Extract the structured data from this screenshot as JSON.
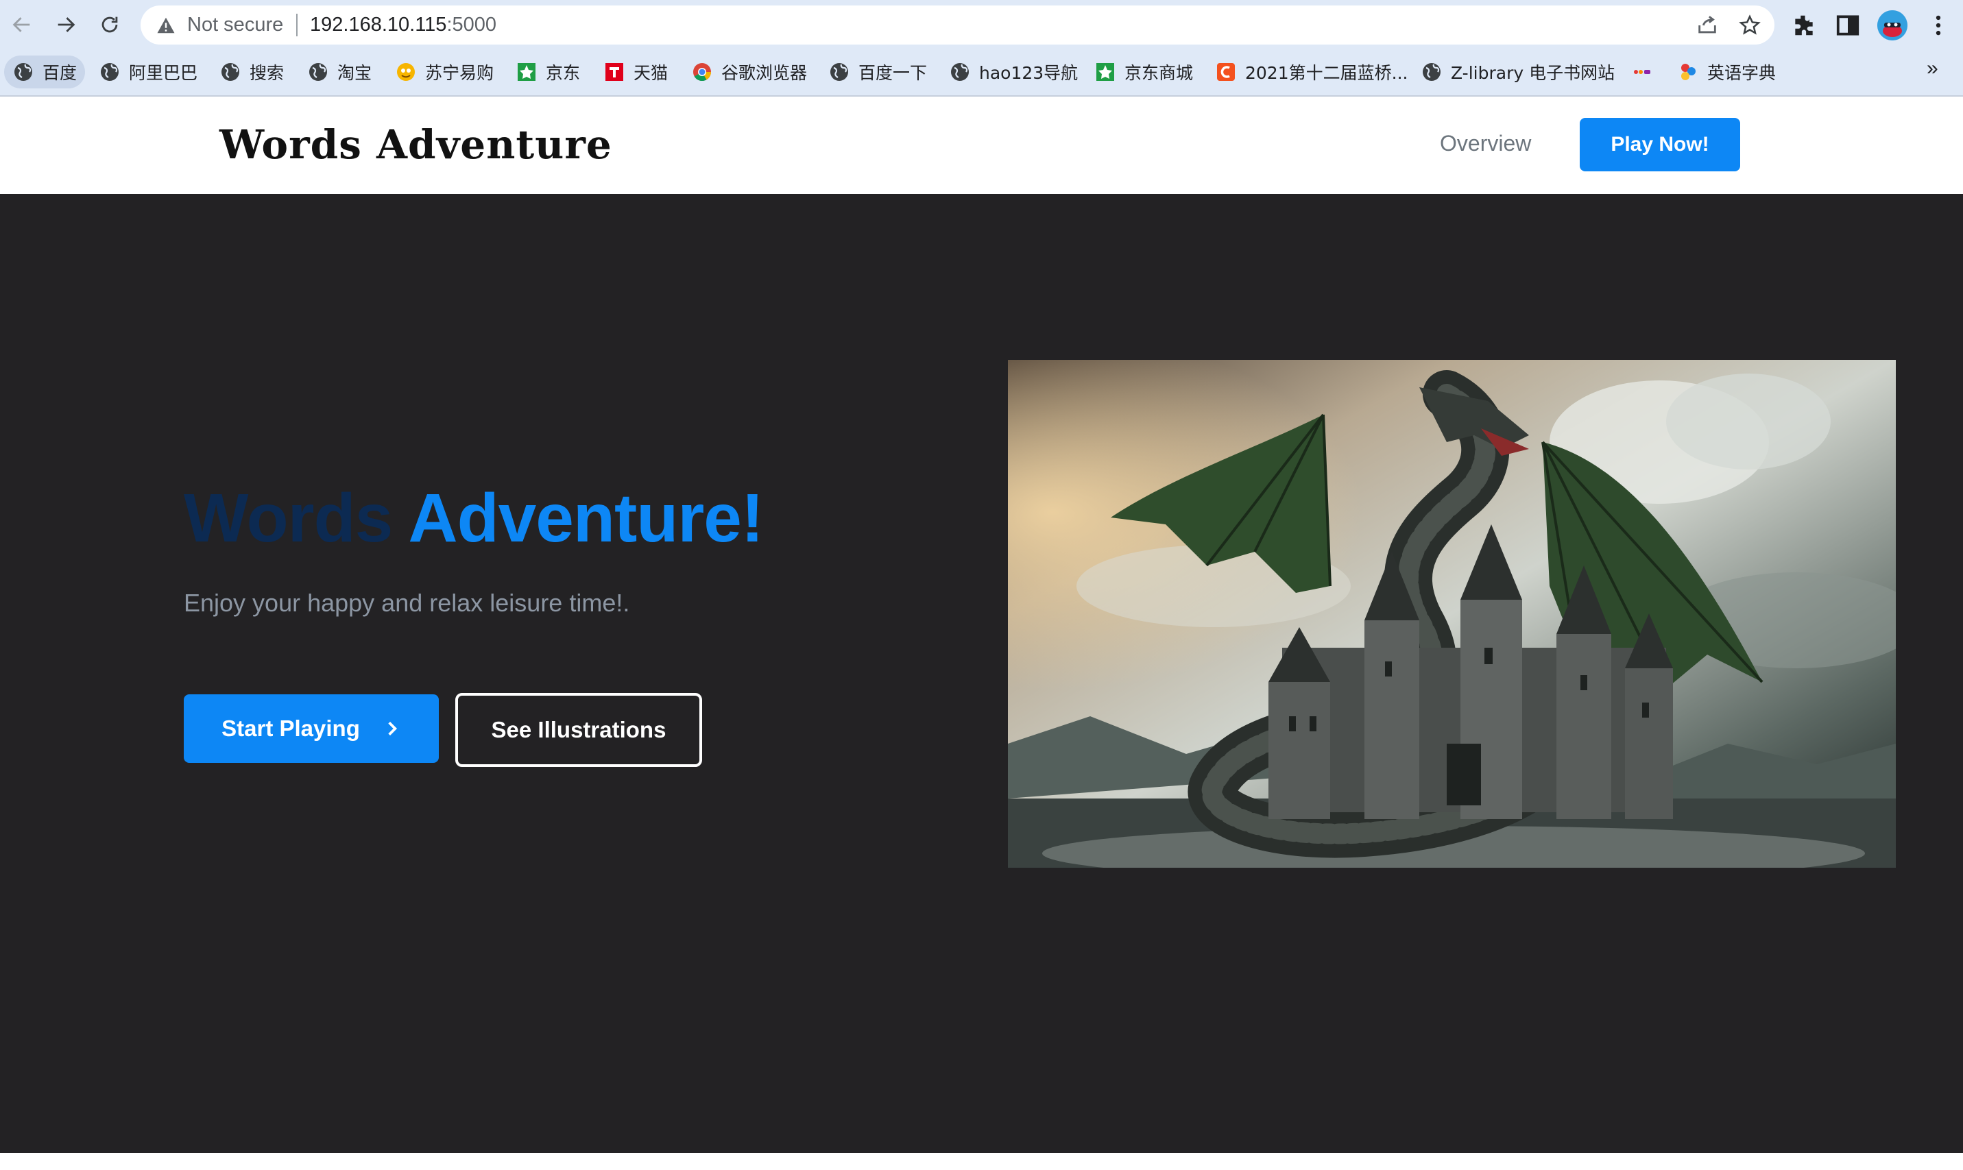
{
  "browser": {
    "security_label": "Not secure",
    "url_host": "192.168.10.115",
    "url_port": ":5000",
    "icons": [
      "back-arrow-icon",
      "forward-arrow-icon",
      "reload-icon",
      "warning-icon",
      "share-icon",
      "star-icon",
      "extensions-icon",
      "side-panel-icon",
      "profile-avatar",
      "more-menu-icon"
    ]
  },
  "bookmarks": [
    {
      "label": "百度",
      "icon": "globe-icon"
    },
    {
      "label": "阿里巴巴",
      "icon": "globe-icon"
    },
    {
      "label": "搜索",
      "icon": "globe-icon"
    },
    {
      "label": "淘宝",
      "icon": "globe-icon"
    },
    {
      "label": "苏宁易购",
      "icon": "suning-icon"
    },
    {
      "label": "京东",
      "icon": "jd-icon"
    },
    {
      "label": "天猫",
      "icon": "tmall-icon"
    },
    {
      "label": "谷歌浏览器",
      "icon": "chrome-icon"
    },
    {
      "label": "百度一下",
      "icon": "globe-icon"
    },
    {
      "label": "hao123导航",
      "icon": "globe-icon"
    },
    {
      "label": "京东商城",
      "icon": "jd-icon"
    },
    {
      "label": "2021第十二届蓝桥...",
      "icon": "c-icon"
    },
    {
      "label": "Z-library 电子书网站",
      "icon": "globe-icon"
    },
    {
      "label": "",
      "icon": "small-logo-icon"
    },
    {
      "label": "英语字典",
      "icon": "dictionary-icon"
    }
  ],
  "bookmarks_more": "»",
  "header": {
    "brand": "Words Adventure",
    "nav_overview": "Overview",
    "nav_play": "Play Now!"
  },
  "hero": {
    "title_part1": "Words",
    "title_part2": "Adventure!",
    "subtitle": "Enjoy your happy and relax leisure time!.",
    "start_button": "Start Playing",
    "illustrations_button": "See Illustrations",
    "image_subject": "dragon coiled around a castle"
  },
  "colors": {
    "accent": "#0d87f5",
    "title_dark": "#0c2a52",
    "hero_bg": "#232224",
    "subtitle": "#8c96a3",
    "chrome_bg": "#dfe9f7"
  }
}
